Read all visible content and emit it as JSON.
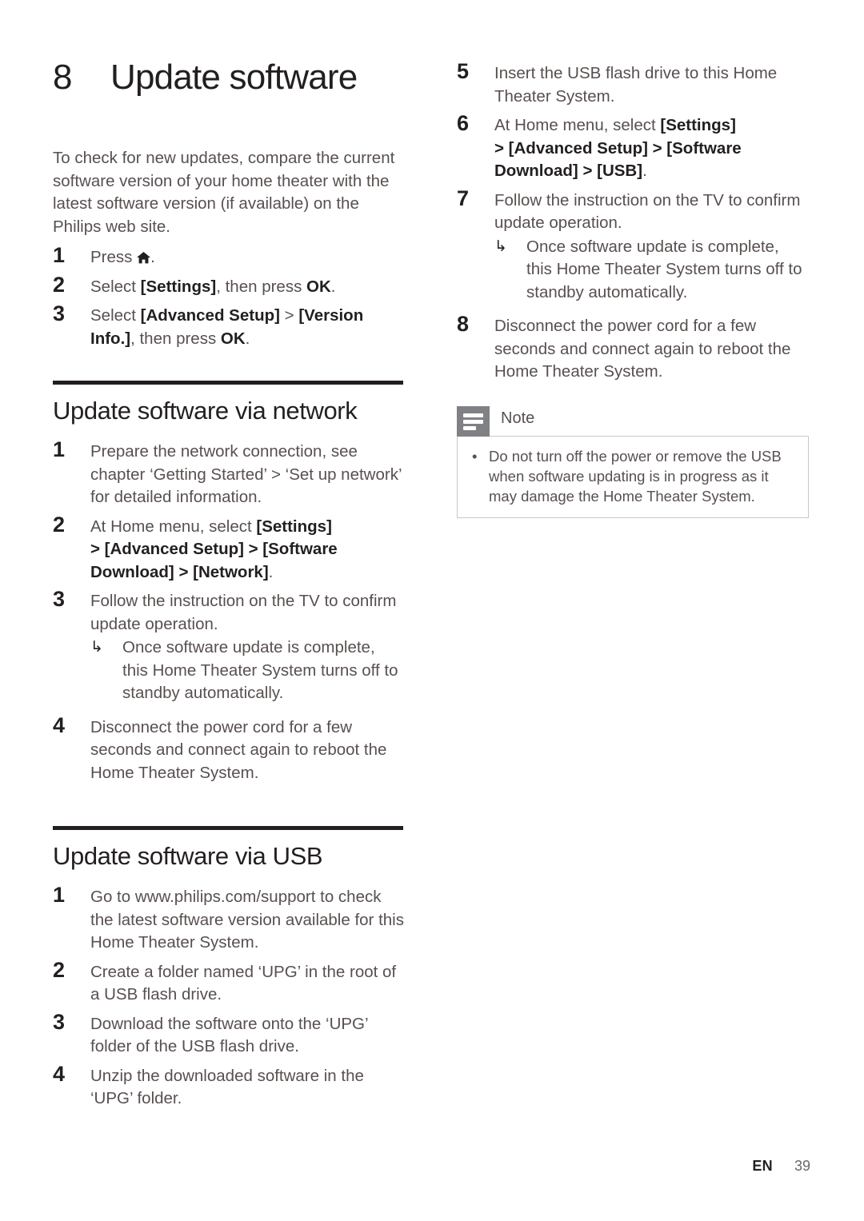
{
  "chapter": {
    "number": "8",
    "title": "Update software"
  },
  "intro": "To check for new updates, compare the current software version of your home theater with the latest software version (if available) on the Philips web site.",
  "intro_steps": [
    {
      "num": "1",
      "text_before": "Press ",
      "icon": "home-icon",
      "text_after": "."
    },
    {
      "num": "2",
      "text": "Select [Settings], then press OK."
    },
    {
      "num": "3",
      "text": "Select [Advanced Setup] > [Version Info.], then press OK."
    }
  ],
  "sections": [
    {
      "heading": "Update software via network",
      "steps": [
        {
          "num": "1",
          "text": "Prepare the network connection, see chapter ‘Getting Started’ > ‘Set up network’ for detailed information."
        },
        {
          "num": "2",
          "text": "At Home menu, select [Settings] > [Advanced Setup] > [Software Download] > [Network]."
        },
        {
          "num": "3",
          "text": "Follow the instruction on the TV to confirm update operation.",
          "substeps": [
            {
              "arrow": "↳",
              "text": "Once software update is complete, this Home Theater System turns off to standby automatically."
            }
          ]
        },
        {
          "num": "4",
          "text": "Disconnect the power cord for a few seconds and connect again to reboot the Home Theater System."
        }
      ]
    },
    {
      "heading": "Update software via USB",
      "steps": [
        {
          "num": "1",
          "text": "Go to www.philips.com/support to check the latest software version available for this Home Theater System."
        },
        {
          "num": "2",
          "text": "Create a folder named ‘UPG’ in the root of a USB flash drive."
        },
        {
          "num": "3",
          "text": "Download the software onto the ‘UPG’ folder of the USB flash drive."
        },
        {
          "num": "4",
          "text": "Unzip the downloaded software in the ‘UPG’ folder."
        }
      ]
    }
  ],
  "usb_steps_continued": [
    {
      "num": "5",
      "text": "Insert the USB flash drive to this Home Theater System."
    },
    {
      "num": "6",
      "text": "At Home menu, select [Settings] > [Advanced Setup] > [Software Download] > [USB]."
    },
    {
      "num": "7",
      "text": "Follow the instruction on the TV to confirm update operation.",
      "substeps": [
        {
          "arrow": "↳",
          "text": "Once software update is complete, this Home Theater System turns off to standby automatically."
        }
      ]
    },
    {
      "num": "8",
      "text": "Disconnect the power cord for a few seconds and connect again to reboot the Home Theater System."
    }
  ],
  "note": {
    "label": "Note",
    "icon": "note-lines-icon",
    "bullet": "•",
    "items": [
      "Do not turn off the power or remove the USB when software updating is in progress as it may damage the Home Theater System."
    ]
  },
  "footer": {
    "language": "EN",
    "page_number": "39"
  },
  "colors": {
    "body_text": "#58504f",
    "heading_text": "#231f20",
    "rule": "#231f20",
    "note_icon_bg": "#808184",
    "note_border": "#c9c9c9"
  }
}
